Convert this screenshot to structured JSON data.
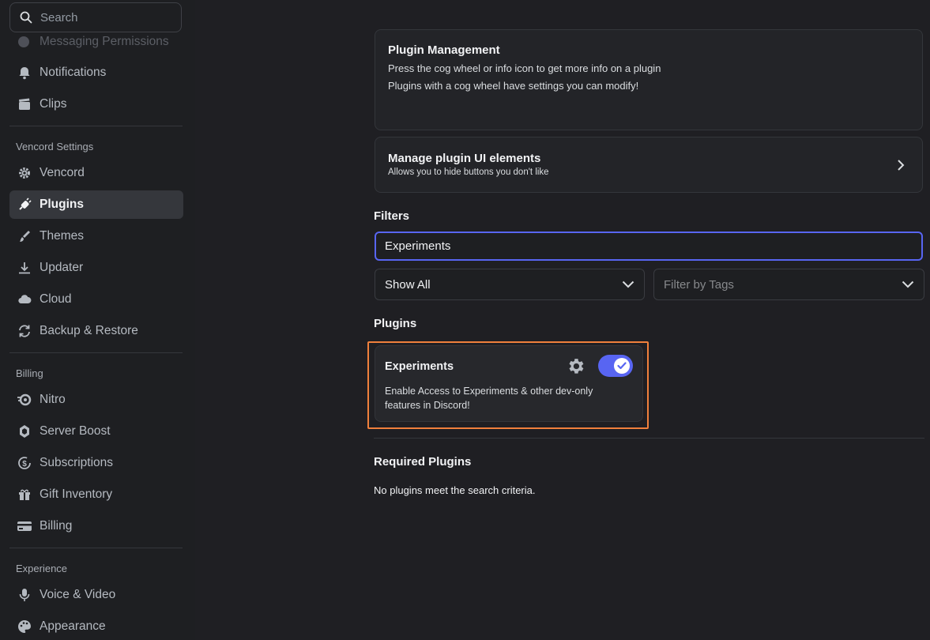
{
  "sidebar": {
    "search_placeholder": "Search",
    "partial_item": "Messaging Permissions",
    "items_top": [
      {
        "label": "Notifications",
        "icon": "bell-icon"
      },
      {
        "label": "Clips",
        "icon": "clapperboard-icon"
      }
    ],
    "vencord_header": "Vencord Settings",
    "vencord_items": [
      {
        "label": "Vencord",
        "icon": "gear-icon"
      },
      {
        "label": "Plugins",
        "icon": "plug-icon",
        "active": true
      },
      {
        "label": "Themes",
        "icon": "paintbrush-icon"
      },
      {
        "label": "Updater",
        "icon": "download-icon"
      },
      {
        "label": "Cloud",
        "icon": "cloud-icon"
      },
      {
        "label": "Backup & Restore",
        "icon": "sync-icon"
      }
    ],
    "billing_header": "Billing",
    "billing_items": [
      {
        "label": "Nitro",
        "icon": "nitro-icon"
      },
      {
        "label": "Server Boost",
        "icon": "boost-gem-icon"
      },
      {
        "label": "Subscriptions",
        "icon": "subscription-icon"
      },
      {
        "label": "Gift Inventory",
        "icon": "gift-icon"
      },
      {
        "label": "Billing",
        "icon": "credit-card-icon"
      }
    ],
    "experience_header": "Experience",
    "experience_items": [
      {
        "label": "Voice & Video",
        "icon": "microphone-icon"
      },
      {
        "label": "Appearance",
        "icon": "palette-icon"
      }
    ]
  },
  "main": {
    "plugin_management": {
      "title": "Plugin Management",
      "line1": "Press the cog wheel or info icon to get more info on a plugin",
      "line2": "Plugins with a cog wheel have settings you can modify!"
    },
    "manage_ui": {
      "title": "Manage plugin UI elements",
      "subtitle": "Allows you to hide buttons you don't like"
    },
    "filters_heading": "Filters",
    "search_value": "Experiments",
    "show_select": "Show All",
    "tags_placeholder": "Filter by Tags",
    "plugins_heading": "Plugins",
    "plugin": {
      "name": "Experiments",
      "description_line1": "Enable Access to Experiments & other dev-only",
      "description_line2": "features in Discord!",
      "enabled": true
    },
    "required_heading": "Required Plugins",
    "no_results": "No plugins meet the search criteria."
  },
  "colors": {
    "accent": "#5865f2",
    "highlight": "#f0803c",
    "background": "#1e1f22"
  }
}
